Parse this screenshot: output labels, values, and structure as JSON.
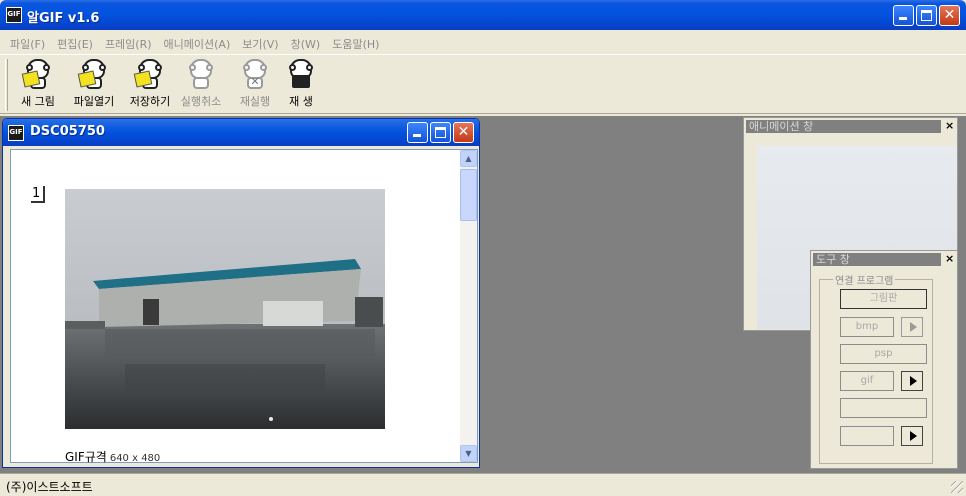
{
  "app": {
    "title": "알GIF v1.6"
  },
  "menu": [
    "파일(F)",
    "편집(E)",
    "프레임(R)",
    "애니메이션(A)",
    "보기(V)",
    "창(W)",
    "도움말(H)"
  ],
  "toolbar": [
    {
      "label": "새 그림",
      "icon": "new-image-icon",
      "enabled": true
    },
    {
      "label": "파일열기",
      "icon": "open-file-icon",
      "enabled": true
    },
    {
      "label": "저장하기",
      "icon": "save-icon",
      "enabled": true
    },
    {
      "label": "실행취소",
      "icon": "undo-icon",
      "enabled": false
    },
    {
      "label": "재실행",
      "icon": "redo-icon",
      "enabled": false
    },
    {
      "label": "재 생",
      "icon": "play-icon",
      "enabled": true
    }
  ],
  "document": {
    "title": "DSC05750",
    "frame_number": "1",
    "caption_label": "GIF규격",
    "caption_dims": "640 x 480"
  },
  "animation_panel": {
    "title": "애니메이션 창",
    "close": "×"
  },
  "tools_panel": {
    "title": "도구 창",
    "close": "×",
    "group_label": "연결 프로그램",
    "buttons": [
      "그림판",
      "bmp",
      "psp",
      "gif",
      "",
      ""
    ]
  },
  "status": {
    "text": "(주)이스트소프트"
  },
  "colors": {
    "title_bar": "#0354e0",
    "mdi_background": "#808080",
    "chrome": "#ece9d8"
  }
}
